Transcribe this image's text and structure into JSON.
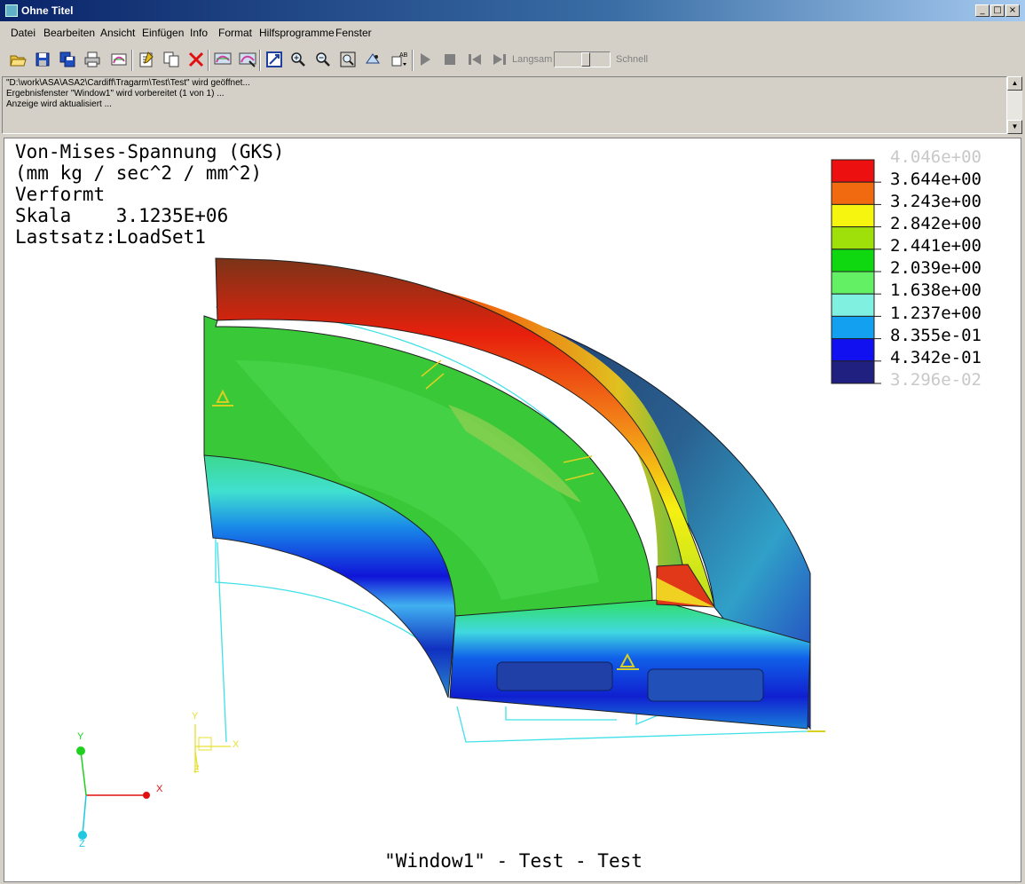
{
  "window": {
    "title": "Ohne Titel"
  },
  "menu": [
    "Datei",
    "Bearbeiten",
    "Ansicht",
    "Einfügen",
    "Info",
    "Format",
    "Hilfsprogramme",
    "Fenster"
  ],
  "toolbar": {
    "icons": [
      "open-icon",
      "save-icon",
      "save-all-icon",
      "print-icon",
      "render-icon",
      "edit-icon",
      "copy-icon",
      "delete-icon",
      "display-icon",
      "display-settings-icon",
      "fit-icon",
      "zoom-in-icon",
      "zoom-out-icon",
      "zoom-window-icon",
      "orient-icon",
      "label-icon",
      "play-icon",
      "stop-icon",
      "rewind-icon",
      "step-icon"
    ],
    "speed_slow": "Langsam",
    "speed_fast": "Schnell",
    "speed_level": 0.5
  },
  "log": {
    "lines": [
      "\"D:\\work\\ASA\\ASA2\\Cardiff\\Tragarm\\Test\\Test\" wird geöffnet...",
      "Ergebnisfenster \"Window1\" wird vorbereitet (1 von 1) ...",
      "Anzeige wird aktualisiert ..."
    ]
  },
  "result": {
    "title": "Von-Mises-Spannung (GKS)",
    "units": "(mm kg / sec^2 / mm^2)",
    "state": "Verformt",
    "scale": "Skala    3.1235E+06",
    "loadset": "Lastsatz:LoadSet1",
    "footer": "\"Window1\" - Test - Test"
  },
  "legend": {
    "labels": [
      "4.046e+00",
      "3.644e+00",
      "3.243e+00",
      "2.842e+00",
      "2.441e+00",
      "2.039e+00",
      "1.638e+00",
      "1.237e+00",
      "8.355e-01",
      "4.342e-01",
      "3.296e-02"
    ],
    "colors": [
      "#ec1010",
      "#f26a10",
      "#f5f510",
      "#a0e00a",
      "#10d810",
      "#64f064",
      "#80f0e0",
      "#14a0f0",
      "#1010f0",
      "#202080"
    ]
  },
  "axes": {
    "x": "X",
    "y": "Y",
    "z": "Z",
    "x_color": "#e01010",
    "y_color": "#20d020",
    "z_color": "#20c8e0",
    "triad_color": "#e6e032"
  }
}
